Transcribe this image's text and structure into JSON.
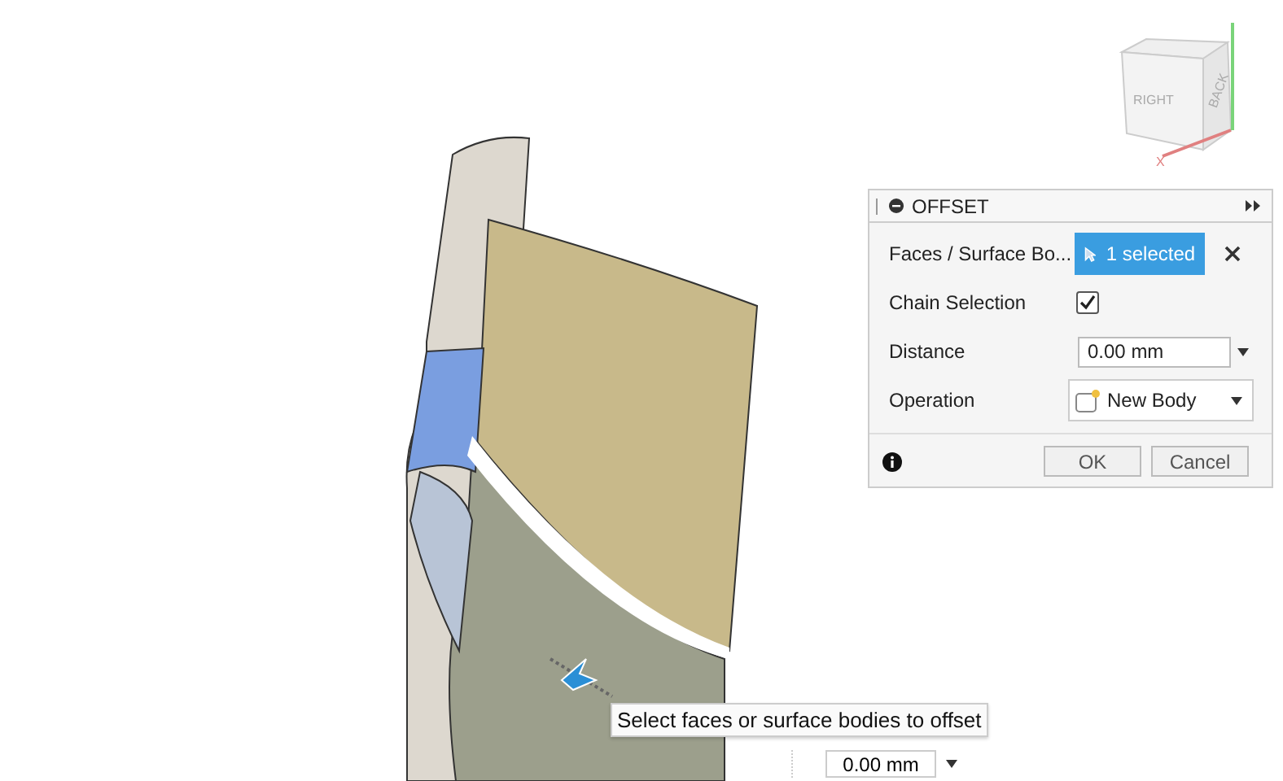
{
  "viewcube": {
    "faces": [
      "RIGHT",
      "BACK"
    ],
    "axis_label": "X"
  },
  "dialog": {
    "title": "OFFSET",
    "rows": [
      {
        "kind": "selection",
        "label": "Faces / Surface Bo...",
        "value": "1 selected"
      },
      {
        "kind": "checkbox",
        "label": "Chain Selection",
        "checked": true
      },
      {
        "kind": "input",
        "label": "Distance",
        "value": "0.00 mm"
      },
      {
        "kind": "dropdown",
        "label": "Operation",
        "value": "New Body"
      }
    ],
    "buttons": [
      "OK",
      "Cancel"
    ]
  },
  "tooltip": "Select faces or surface bodies to offset",
  "distance_field": {
    "value": "0.00 mm"
  }
}
